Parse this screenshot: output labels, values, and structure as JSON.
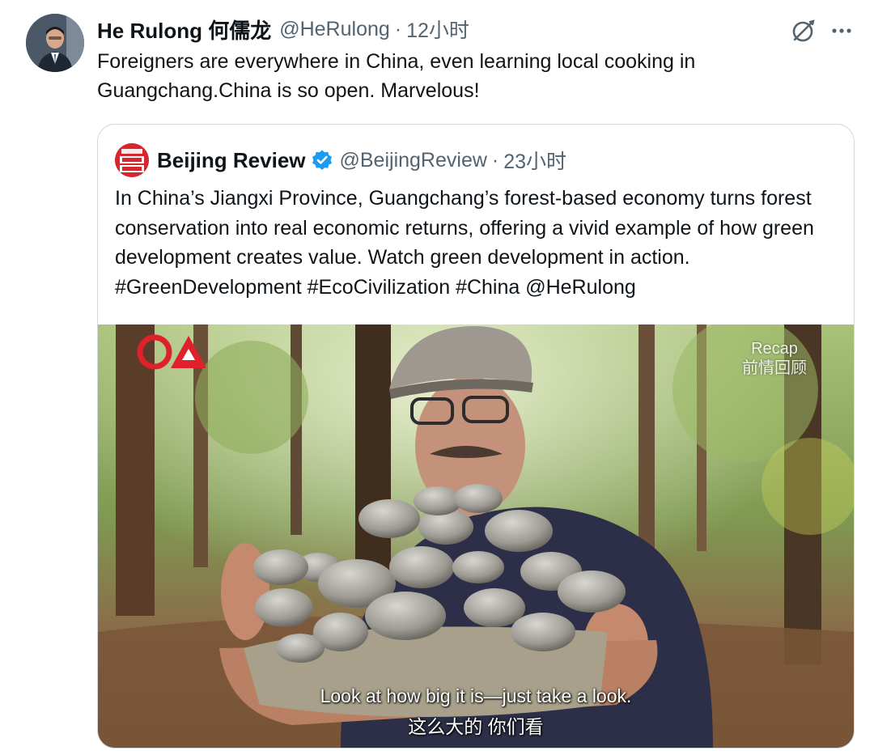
{
  "tweet": {
    "author_name": "He Rulong 何儒龙",
    "handle": "@HeRulong",
    "separator": "·",
    "time": "12小时",
    "text": "Foreigners are everywhere in China, even learning local cooking in Guangchang.China is so open. Marvelous!",
    "icons": {
      "grok": "grok-icon",
      "more": "more-icon"
    }
  },
  "quote": {
    "author_name": "Beijing Review",
    "handle": "@BeijingReview",
    "separator": "·",
    "time": "23小时",
    "text": "In China’s Jiangxi Province, Guangchang’s forest-based economy turns forest conservation into real economic returns, offering a vivid example of how green development creates value. Watch green development in action. #GreenDevelopment #EcoCivilization #China @HeRulong",
    "logo_text": "BEIJING REVIEW",
    "video": {
      "recap_en": "Recap",
      "recap_zh": "前情回顾",
      "subtitle_en": "Look at how big it is—just take a look.",
      "subtitle_zh": "这么大的 你们看"
    }
  },
  "colors": {
    "text": "#0f1419",
    "muted": "#536471",
    "border": "#cfd9de",
    "verified": "#1d9bf0",
    "logo_red": "#d7262d"
  }
}
